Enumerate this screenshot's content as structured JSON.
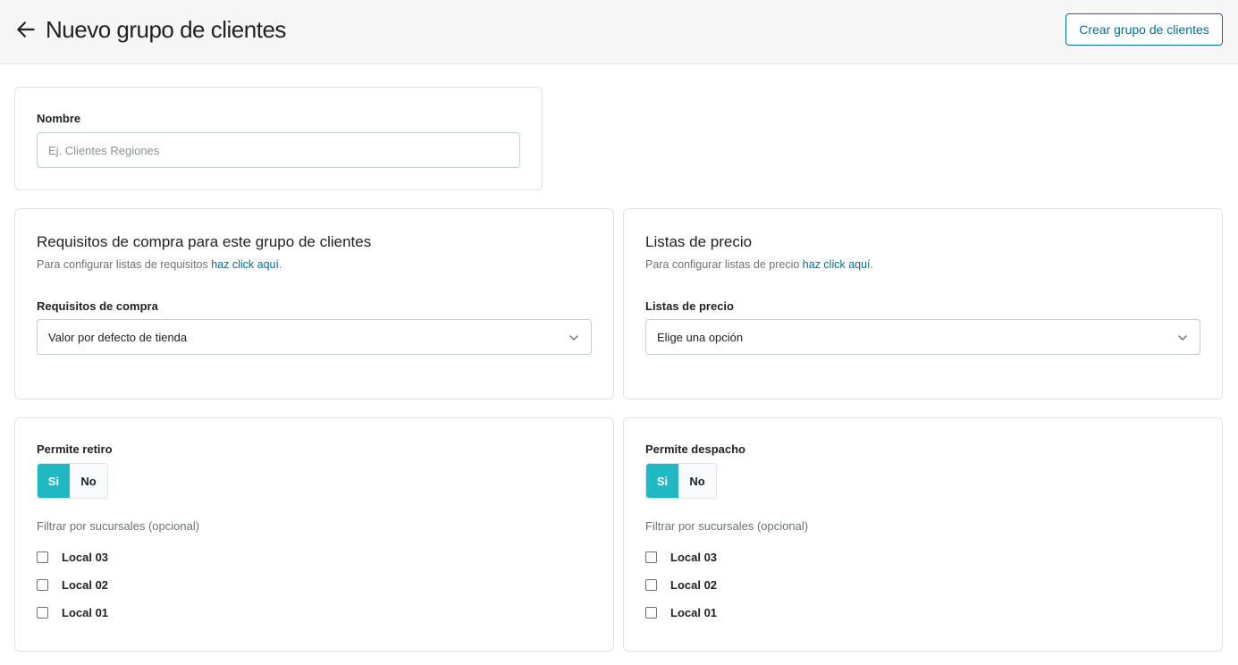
{
  "header": {
    "title": "Nuevo grupo de clientes",
    "create_button": "Crear grupo de clientes"
  },
  "name_card": {
    "label": "Nombre",
    "placeholder": "Ej. Clientes Regiones",
    "value": ""
  },
  "requirements_card": {
    "title": "Requisitos de compra para este grupo de clientes",
    "subtitle_prefix": "Para configurar listas de requisitos",
    "subtitle_link": "haz click aquí",
    "subtitle_suffix": ".",
    "field_label": "Requisitos de compra",
    "selected": "Valor por defecto de tienda"
  },
  "price_card": {
    "title": "Listas de precio",
    "subtitle_prefix": "Para configurar listas de precio",
    "subtitle_link": "haz click aquí",
    "subtitle_suffix": ".",
    "field_label": "Listas de precio",
    "selected": "Elige una opción"
  },
  "pickup_card": {
    "label": "Permite retiro",
    "toggle_yes": "Si",
    "toggle_no": "No",
    "active": "yes",
    "filter_label": "Filtrar por sucursales (opcional)",
    "branches": [
      {
        "label": "Local 03",
        "checked": false
      },
      {
        "label": "Local 02",
        "checked": false
      },
      {
        "label": "Local 01",
        "checked": false
      }
    ]
  },
  "dispatch_card": {
    "label": "Permite despacho",
    "toggle_yes": "Si",
    "toggle_no": "No",
    "active": "yes",
    "filter_label": "Filtrar por sucursales (opcional)",
    "branches": [
      {
        "label": "Local 03",
        "checked": false
      },
      {
        "label": "Local 02",
        "checked": false
      },
      {
        "label": "Local 01",
        "checked": false
      }
    ]
  },
  "colors": {
    "accent": "#1fb9c3",
    "link": "#006e96",
    "border": "#dfe3e8",
    "header_bg": "#f6f6f7"
  },
  "icons": {
    "back": "arrow-left-icon",
    "dropdown": "chevron-down-icon"
  }
}
